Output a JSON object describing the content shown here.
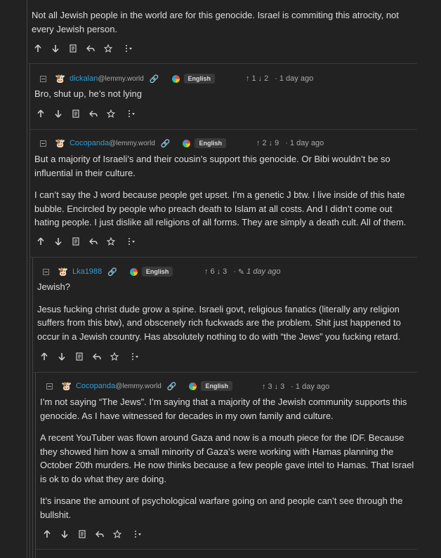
{
  "top": {
    "text": "Not all Jewish people in the world are for this genocide. Israel is commiting this atrocity, not every Jewish person."
  },
  "comments": [
    {
      "username": "dickalan",
      "instance": "@lemmy.world",
      "language": "English",
      "upvotes": "1",
      "downvotes": "2",
      "time": "1 day ago",
      "paragraphs": [
        "Bro, shut up, he’s not lying"
      ]
    },
    {
      "username": "Cocopanda",
      "instance": "@lemmy.world",
      "language": "English",
      "upvotes": "2",
      "downvotes": "9",
      "time": "1 day ago",
      "paragraphs": [
        "But a majority of Israeli’s and their cousin’s support this genocide. Or Bibi wouldn’t be so influential in their culture.",
        "I can’t say the J word because people get upset. I’m a genetic J btw. I live inside of this hate bubble. Encircled by people who preach death to Islam at all costs. And I didn’t come out hating people. I just dislike all religions of all forms. They are simply a death cult. All of them."
      ]
    },
    {
      "username": "Lka1988",
      "instance": "",
      "language": "English",
      "upvotes": "6",
      "downvotes": "3",
      "time": "1 day ago",
      "paragraphs": [
        "Jewish?",
        "Jesus fucking christ dude grow a spine. Israeli govt, religious fanatics (literally any religion suffers from this btw), and obscenely rich fuckwads are the problem. Shit just happened to occur in a Jewish country. Has absolutely nothing to do with “the Jews” you fucking retard."
      ]
    },
    {
      "username": "Cocopanda",
      "instance": "@lemmy.world",
      "language": "English",
      "upvotes": "3",
      "downvotes": "3",
      "time": "1 day ago",
      "paragraphs": [
        "I’m not saying “The Jews”. I’m saying that a majority of the Jewish community supports this genocide. As I have witnessed for decades in my own family and culture.",
        "A recent YouTuber was flown around Gaza and now is a mouth piece for the IDF. Because they showed him how a small minority of Gaza’s were working with Hamas planning the October 20th murders. He now thinks because a few people gave intel to Hamas. That Israel is ok to do what they are doing.",
        "It’s insane the amount of psychological warfare going on and people can’t see through the bullshit."
      ]
    }
  ]
}
